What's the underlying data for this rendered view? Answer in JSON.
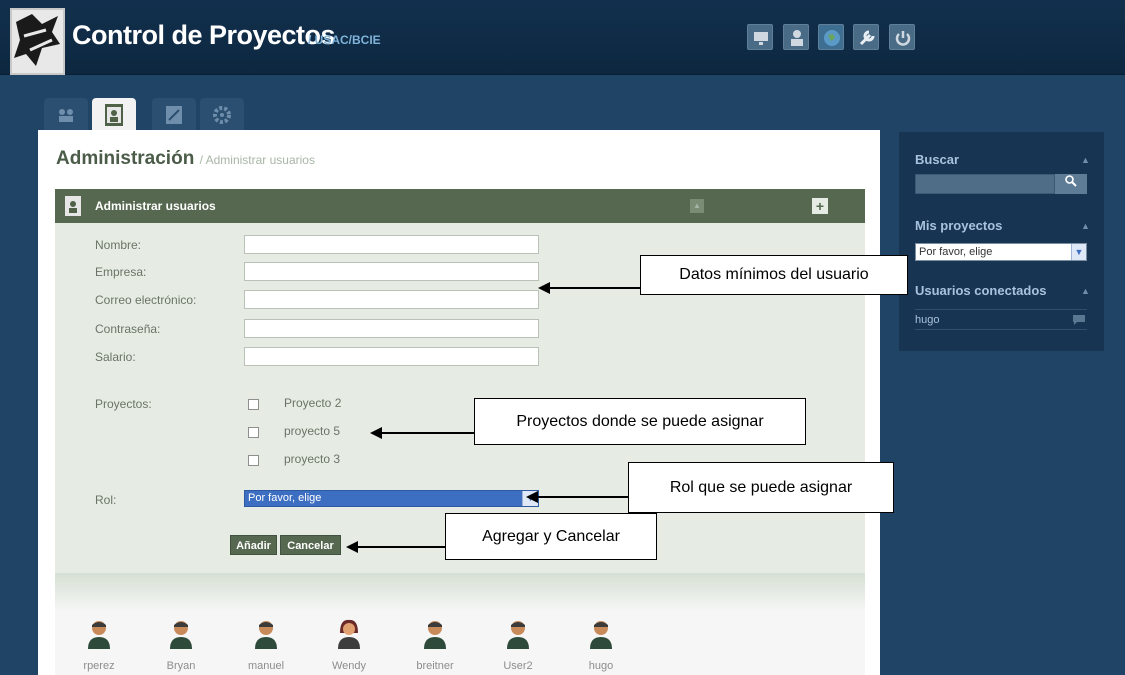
{
  "header": {
    "title": "Control de Proyectos",
    "subtitle": "/ USAC/BCIE",
    "icons": [
      "monitor-icon",
      "user-icon",
      "globe-icon",
      "wrench-icon",
      "power-icon"
    ]
  },
  "tabs": [
    "users-tab",
    "user-card-tab",
    "edit-tab",
    "settings-tab"
  ],
  "page": {
    "title": "Administración",
    "subtitle": "/ Administrar usuarios"
  },
  "form": {
    "header": "Administrar usuarios",
    "labels": {
      "nombre": "Nombre:",
      "empresa": "Empresa:",
      "correo": "Correo electrónico:",
      "contrasena": "Contraseña:",
      "salario": "Salario:",
      "proyectos": "Proyectos:",
      "rol": "Rol:"
    },
    "projects": [
      "Proyecto 2",
      "proyecto 5",
      "proyecto 3"
    ],
    "rol_value": "Por favor, elige",
    "buttons": {
      "add": "Añadir",
      "cancel": "Cancelar"
    }
  },
  "users": [
    "rperez",
    "Bryan",
    "manuel",
    "Wendy",
    "breitner",
    "User2",
    "hugo"
  ],
  "sidebar": {
    "search_title": "Buscar",
    "projects_title": "Mis proyectos",
    "projects_select": "Por favor, elige",
    "online_title": "Usuarios conectados",
    "online_user": "hugo"
  },
  "annotations": {
    "datos": "Datos mínimos del usuario",
    "proyectos": "Proyectos donde se puede asignar",
    "rol": "Rol que se puede asignar",
    "botones": "Agregar y  Cancelar"
  },
  "colors": {
    "header_bg": "#12304d",
    "accent_green": "#56684f",
    "form_bg": "#e6ece4",
    "select_blue": "#3c6ec2"
  }
}
